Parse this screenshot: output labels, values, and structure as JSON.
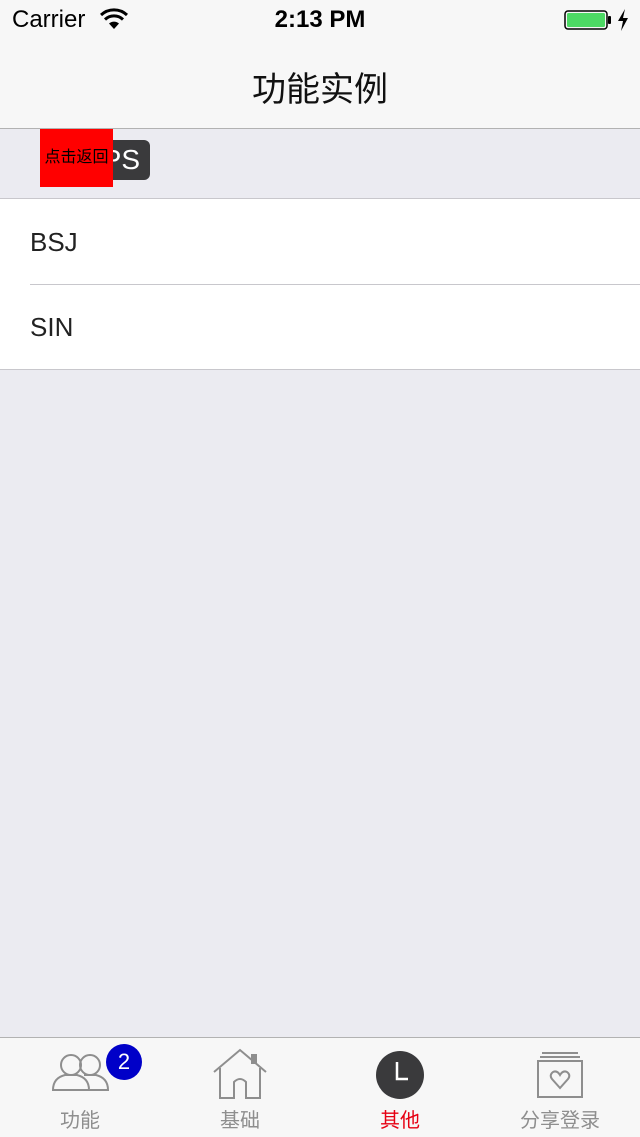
{
  "status_bar": {
    "carrier": "Carrier",
    "time": "2:13 PM",
    "battery_color": "#4cd964"
  },
  "nav": {
    "title": "功能实例"
  },
  "section": {
    "chip_text": "PS",
    "back_button_label": "点击返回"
  },
  "list": {
    "items": [
      {
        "label": "BSJ"
      },
      {
        "label": "SIN"
      }
    ]
  },
  "tab_bar": {
    "active_color": "#e60012",
    "inactive_color": "#8e8e8e",
    "tabs": [
      {
        "label": "功能",
        "icon": "users-icon",
        "badge": "2"
      },
      {
        "label": "基础",
        "icon": "home-icon"
      },
      {
        "label": "其他",
        "icon": "clock-icon",
        "active": true
      },
      {
        "label": "分享登录",
        "icon": "share-heart-icon"
      }
    ]
  }
}
